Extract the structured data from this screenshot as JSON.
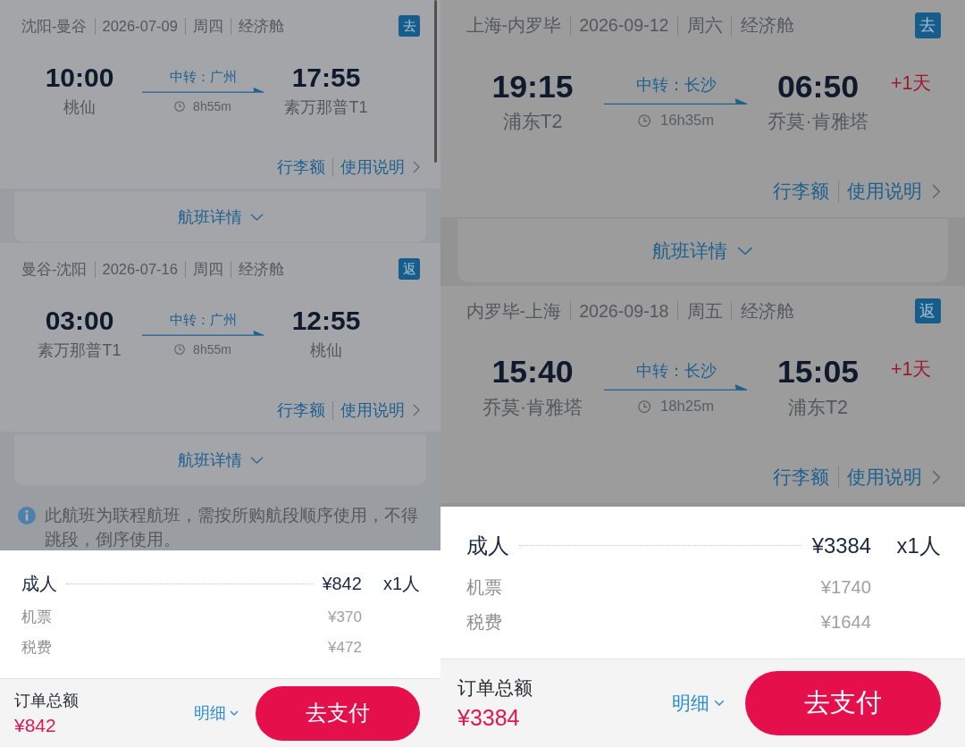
{
  "panels": [
    {
      "scrollbar": true,
      "trips": [
        {
          "route": "沈阳-曼谷",
          "date": "2026-07-09",
          "weekday": "周四",
          "cabin": "经济舱",
          "badge": "去",
          "depart_time": "10:00",
          "depart_airport": "桃仙",
          "transfer": "中转：广州",
          "duration": "8h55m",
          "arrive_time": "17:55",
          "arrive_airport": "素万那普T1",
          "links": [
            "行李额",
            "使用说明"
          ],
          "details_label": "航班详情"
        },
        {
          "route": "曼谷-沈阳",
          "date": "2026-07-16",
          "weekday": "周四",
          "cabin": "经济舱",
          "badge": "返",
          "depart_time": "03:00",
          "depart_airport": "素万那普T1",
          "transfer": "中转：广州",
          "duration": "8h55m",
          "arrive_time": "12:55",
          "arrive_airport": "桃仙",
          "links": [
            "行李额",
            "使用说明"
          ],
          "details_label": "航班详情"
        }
      ],
      "notice": "此航班为联程航班，需按所购航段顺序使用，不得跳段，倒序使用。",
      "fare": {
        "passenger": "成人",
        "total": "¥842",
        "count": "x1人",
        "items": [
          {
            "label": "机票",
            "amount": "¥370"
          },
          {
            "label": "税费",
            "amount": "¥472"
          }
        ]
      },
      "footer": {
        "total_label": "订单总额",
        "total": "¥842",
        "details_toggle": "明细",
        "pay_button": "去支付"
      }
    },
    {
      "trips": [
        {
          "route": "上海-内罗毕",
          "date": "2026-09-12",
          "weekday": "周六",
          "cabin": "经济舱",
          "badge": "去",
          "depart_time": "19:15",
          "depart_airport": "浦东T2",
          "transfer": "中转：长沙",
          "duration": "16h35m",
          "arrive_time": "06:50",
          "arrive_airport": "乔莫·肯雅塔",
          "next_day": "+1天",
          "links": [
            "行李额",
            "使用说明"
          ],
          "details_label": "航班详情"
        },
        {
          "route": "内罗毕-上海",
          "date": "2026-09-18",
          "weekday": "周五",
          "cabin": "经济舱",
          "badge": "返",
          "depart_time": "15:40",
          "depart_airport": "乔莫·肯雅塔",
          "transfer": "中转：长沙",
          "duration": "18h25m",
          "arrive_time": "15:05",
          "arrive_airport": "浦东T2",
          "next_day": "+1天",
          "links": [
            "行李额",
            "使用说明"
          ]
        }
      ],
      "fare": {
        "passenger": "成人",
        "total": "¥3384",
        "count": "x1人",
        "items": [
          {
            "label": "机票",
            "amount": "¥1740"
          },
          {
            "label": "税费",
            "amount": "¥1644"
          }
        ]
      },
      "footer": {
        "total_label": "订单总额",
        "total": "¥3384",
        "details_toggle": "明细",
        "pay_button": "去支付"
      }
    }
  ]
}
